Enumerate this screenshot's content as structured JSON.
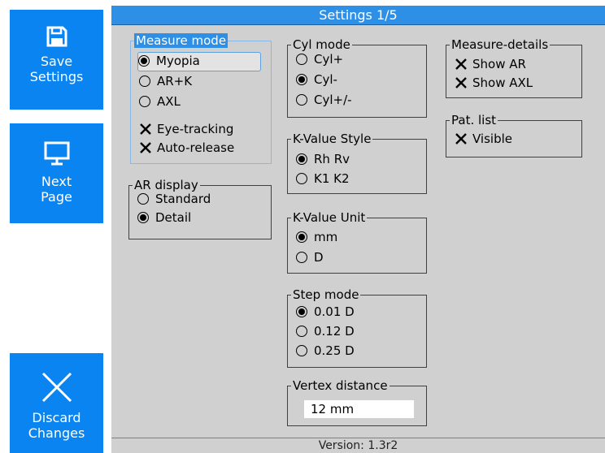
{
  "sidebar": {
    "save": {
      "label1": "Save",
      "label2": "Settings",
      "icon": "save-icon"
    },
    "next": {
      "label1": "Next",
      "label2": "Page",
      "icon": "monitor-icon"
    },
    "discard": {
      "label1": "Discard",
      "label2": "Changes",
      "icon": "close-icon"
    }
  },
  "title": "Settings 1/5",
  "footer": "Version: 1.3r2",
  "measure_mode": {
    "label": "Measure mode",
    "options": [
      "Myopia",
      "AR+K",
      "AXL"
    ],
    "selected": "Myopia",
    "checks": [
      {
        "label": "Eye-tracking",
        "checked": true
      },
      {
        "label": "Auto-release",
        "checked": true
      }
    ]
  },
  "ar_display": {
    "label": "AR display",
    "options": [
      "Standard",
      "Detail"
    ],
    "selected": "Detail"
  },
  "cyl_mode": {
    "label": "Cyl mode",
    "options": [
      "Cyl+",
      "Cyl-",
      "Cyl+/-"
    ],
    "selected": "Cyl-"
  },
  "k_value_style": {
    "label": "K-Value Style",
    "options": [
      "Rh Rv",
      "K1 K2"
    ],
    "selected": "Rh Rv"
  },
  "k_value_unit": {
    "label": "K-Value Unit",
    "options": [
      "mm",
      "D"
    ],
    "selected": "mm"
  },
  "step_mode": {
    "label": "Step mode",
    "options": [
      "0.01 D",
      "0.12 D",
      "0.25 D"
    ],
    "selected": "0.01 D"
  },
  "vertex_distance": {
    "label": "Vertex distance",
    "value": "12 mm"
  },
  "measure_details": {
    "label": "Measure-details",
    "checks": [
      {
        "label": "Show AR",
        "checked": true
      },
      {
        "label": "Show AXL",
        "checked": true
      }
    ]
  },
  "pat_list": {
    "label": "Pat. list",
    "checks": [
      {
        "label": "Visible",
        "checked": true
      }
    ]
  },
  "colors": {
    "accent": "#0a84f0",
    "title_bar": "#2e8fe6",
    "panel": "#d0d0d0"
  }
}
